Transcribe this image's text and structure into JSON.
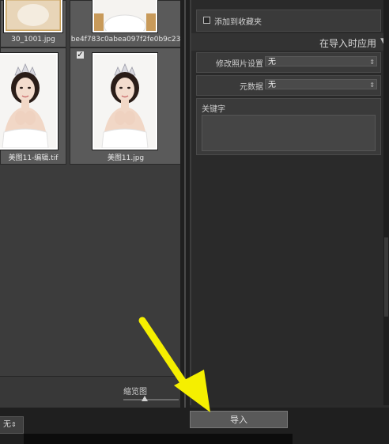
{
  "grid": {
    "files": [
      {
        "name": "30_1001.jpg"
      },
      {
        "name": "be4f783c0abea097f2fe0b9c23"
      },
      {
        "name": "美图11-编辑.tif"
      },
      {
        "name": "美图11.jpg"
      }
    ],
    "thumbnail_label": "缩览图",
    "sort_value": "无"
  },
  "panel": {
    "add_collection_label": "添加到收藏夹",
    "apply_section_title": "在导入时应用",
    "develop_settings_label": "修改照片设置",
    "develop_settings_value": "无",
    "metadata_label": "元数据",
    "metadata_value": "无",
    "keywords_label": "关键字"
  },
  "footer": {
    "import_label": "导入"
  },
  "icons": {
    "select_arrow": "updown-arrow-icon",
    "annotation": "yellow-arrow-icon"
  },
  "colors": {
    "annotation_arrow": "#f5ef00"
  }
}
